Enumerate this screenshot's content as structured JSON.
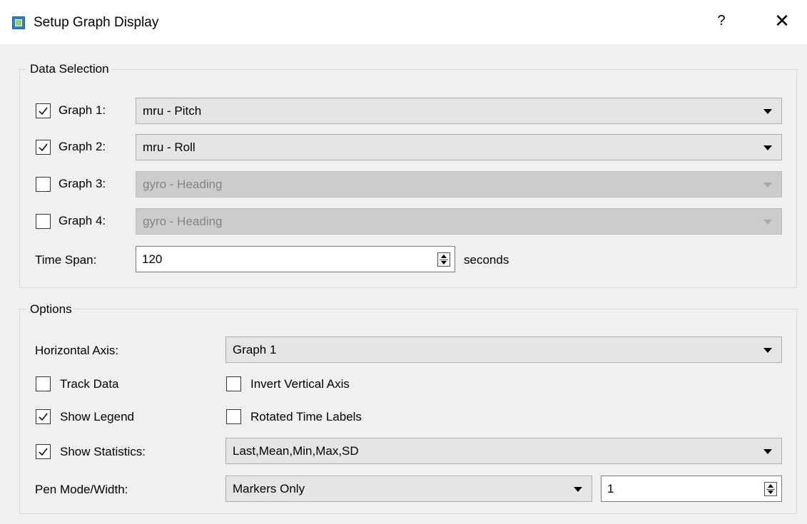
{
  "window": {
    "title": "Setup Graph Display",
    "help_label": "?",
    "close_label": "✕"
  },
  "data_selection": {
    "title": "Data Selection",
    "graphs": [
      {
        "label": "Graph 1:",
        "checked": true,
        "value": "mru - Pitch",
        "enabled": true
      },
      {
        "label": "Graph 2:",
        "checked": true,
        "value": "mru - Roll",
        "enabled": true
      },
      {
        "label": "Graph 3:",
        "checked": false,
        "value": "gyro - Heading",
        "enabled": false
      },
      {
        "label": "Graph 4:",
        "checked": false,
        "value": "gyro - Heading",
        "enabled": false
      }
    ],
    "time_span": {
      "label": "Time Span:",
      "value": "120",
      "unit": "seconds"
    }
  },
  "options": {
    "title": "Options",
    "horizontal_axis": {
      "label": "Horizontal Axis:",
      "value": "Graph 1"
    },
    "track_data": {
      "label": "Track Data",
      "checked": false
    },
    "invert_vertical_axis": {
      "label": "Invert Vertical Axis",
      "checked": false
    },
    "show_legend": {
      "label": "Show Legend",
      "checked": true
    },
    "rotated_time_labels": {
      "label": "Rotated Time Labels",
      "checked": false
    },
    "show_statistics": {
      "label": "Show Statistics:",
      "checked": true,
      "value": "Last,Mean,Min,Max,SD"
    },
    "pen_mode": {
      "label": "Pen Mode/Width:",
      "mode": "Markers Only",
      "width": "1"
    }
  },
  "icons": {
    "checkmark": "checkmark-icon",
    "dropdown": "chevron-down-icon",
    "spin": "spinner-arrows-icon"
  },
  "colors": {
    "dialog_bg": "#f0f0f0",
    "combo_bg": "#e5e5e5",
    "combo_disabled_bg": "#cccccc",
    "disabled_text": "#838383"
  }
}
